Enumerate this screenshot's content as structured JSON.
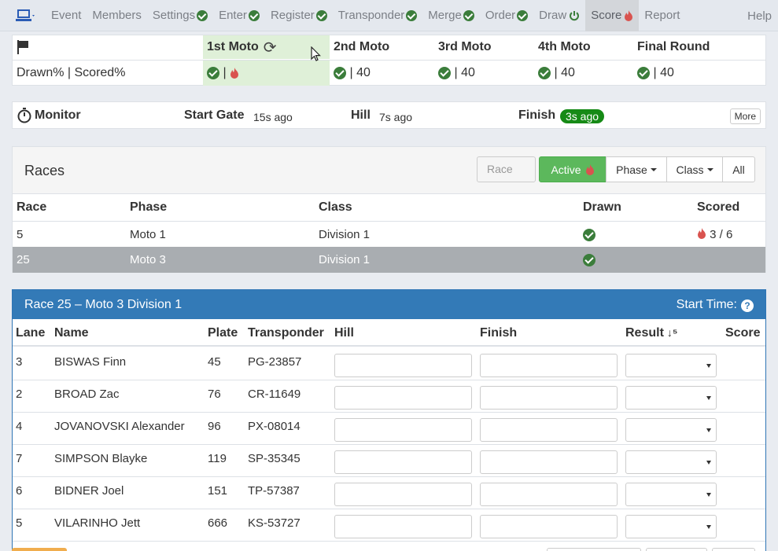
{
  "nav": {
    "items": [
      {
        "label": "Event",
        "check": false
      },
      {
        "label": "Members",
        "check": false
      },
      {
        "label": "Settings",
        "check": true
      },
      {
        "label": "Enter",
        "check": true
      },
      {
        "label": "Register",
        "check": true
      },
      {
        "label": "Transponder",
        "check": true
      },
      {
        "label": "Merge",
        "check": true
      },
      {
        "label": "Order",
        "check": true
      },
      {
        "label": "Draw",
        "power": true
      },
      {
        "label": "Score",
        "flame": true,
        "active": true
      },
      {
        "label": "Report",
        "check": false
      }
    ],
    "help": "Help"
  },
  "progress": {
    "row_label": "Drawn% | Scored%",
    "columns": [
      {
        "label": "1st Moto",
        "scored": "",
        "highlight": true
      },
      {
        "label": "2nd Moto",
        "scored": "40"
      },
      {
        "label": "3rd Moto",
        "scored": "40"
      },
      {
        "label": "4th Moto",
        "scored": "40"
      },
      {
        "label": "Final Round",
        "scored": "40"
      }
    ],
    "sep": "|"
  },
  "monitor": {
    "title": "Monitor",
    "start_gate_label": "Start Gate",
    "start_gate_ago": "15s ago",
    "hill_label": "Hill",
    "hill_ago": "7s ago",
    "finish_label": "Finish",
    "finish_ago": "3s ago",
    "more": "More"
  },
  "races": {
    "title": "Races",
    "filter_placeholder": "Race",
    "active_label": "Active",
    "phase_label": "Phase",
    "class_label": "Class",
    "all_label": "All",
    "headers": {
      "race": "Race",
      "phase": "Phase",
      "class": "Class",
      "drawn": "Drawn",
      "scored": "Scored"
    },
    "rows": [
      {
        "race": "5",
        "phase": "Moto 1",
        "class": "Division 1",
        "scored": "3 / 6"
      },
      {
        "race": "25",
        "phase": "Moto 3",
        "class": "Division 1",
        "scored": ""
      }
    ]
  },
  "detail": {
    "title": "Race 25 – Moto 3 Division 1",
    "start_time": "Start Time:",
    "headers": {
      "lane": "Lane",
      "name": "Name",
      "plate": "Plate",
      "transponder": "Transponder",
      "hill": "Hill",
      "finish": "Finish",
      "result": "Result",
      "score": "Score"
    },
    "riders": [
      {
        "lane": "3",
        "name": "BISWAS Finn",
        "plate": "45",
        "transponder": "PG-23857"
      },
      {
        "lane": "2",
        "name": "BROAD Zac",
        "plate": "76",
        "transponder": "CR-11649"
      },
      {
        "lane": "4",
        "name": "JOVANOVSKI Alexander",
        "plate": "96",
        "transponder": "PX-08014"
      },
      {
        "lane": "7",
        "name": "SIMPSON Blayke",
        "plate": "119",
        "transponder": "SP-35345"
      },
      {
        "lane": "6",
        "name": "BIDNER Joel",
        "plate": "151",
        "transponder": "TP-57387"
      },
      {
        "lane": "5",
        "name": "VILARINHO Jett",
        "plate": "666",
        "transponder": "KS-53727"
      }
    ]
  },
  "colors": {
    "accent": "#337ab7",
    "success": "#5cb85c",
    "check": "#3b7d3b",
    "flame": "#d9534f",
    "selected_row": "#a9adb1"
  }
}
